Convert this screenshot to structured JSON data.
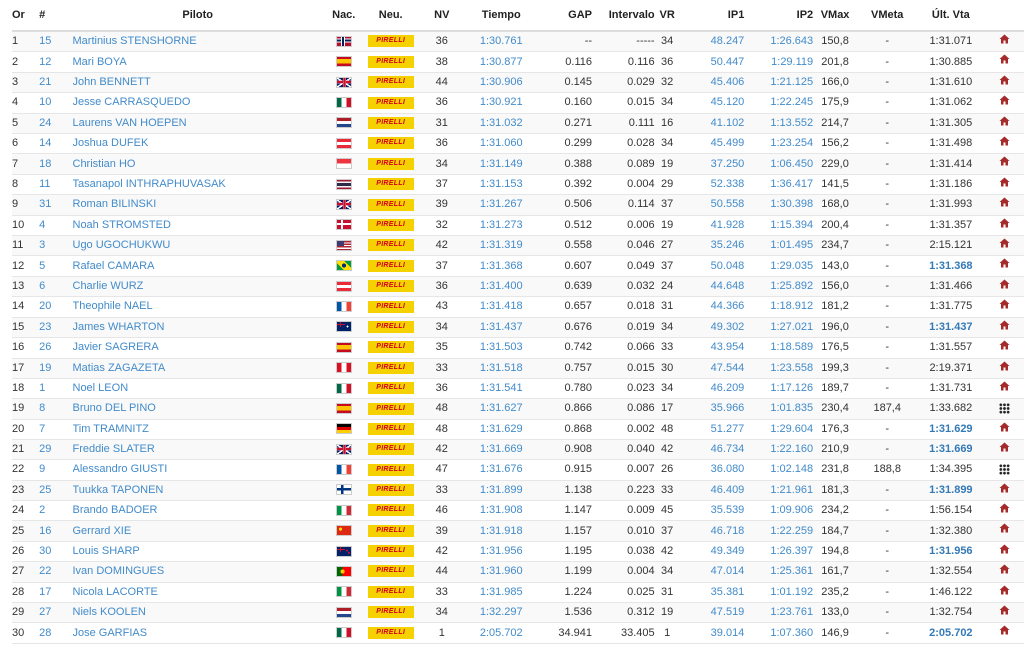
{
  "headers": {
    "or": "Or",
    "num": "#",
    "piloto": "Piloto",
    "nac": "Nac.",
    "neu": "Neu.",
    "nv": "NV",
    "tiempo": "Tiempo",
    "gap": "GAP",
    "intervalo": "Intervalo",
    "vr": "VR",
    "ip1": "IP1",
    "ip2": "IP2",
    "vmax": "VMax",
    "vmeta": "VMeta",
    "ultvta": "Últ. Vta"
  },
  "tyre_label": "PIRELLI",
  "colors": {
    "link": "#428bca",
    "best": "#337ab7",
    "house": "#a52a2a",
    "tyre_bg": "#f5d100",
    "tyre_text": "#d6001c"
  },
  "rows": [
    {
      "or": "1",
      "num": "15",
      "piloto": "Martinius STENSHORNE",
      "flag": "NO",
      "nv": "36",
      "tiempo": "1:30.761",
      "gap": "--",
      "intervalo": "-----",
      "vr": "34",
      "ip1": "48.247",
      "ip2": "1:26.643",
      "vmax": "150,8",
      "vmeta": "-",
      "ult": "1:31.071",
      "best": false,
      "icon": "home-icon"
    },
    {
      "or": "2",
      "num": "12",
      "piloto": "Mari BOYA",
      "flag": "ES",
      "nv": "38",
      "tiempo": "1:30.877",
      "gap": "0.116",
      "intervalo": "0.116",
      "vr": "36",
      "ip1": "50.447",
      "ip2": "1:29.119",
      "vmax": "201,8",
      "vmeta": "-",
      "ult": "1:30.885",
      "best": false,
      "icon": "home-icon"
    },
    {
      "or": "3",
      "num": "21",
      "piloto": "John BENNETT",
      "flag": "GB",
      "nv": "44",
      "tiempo": "1:30.906",
      "gap": "0.145",
      "intervalo": "0.029",
      "vr": "32",
      "ip1": "45.406",
      "ip2": "1:21.125",
      "vmax": "166,0",
      "vmeta": "-",
      "ult": "1:31.610",
      "best": false,
      "icon": "home-icon"
    },
    {
      "or": "4",
      "num": "10",
      "piloto": "Jesse CARRASQUEDO",
      "flag": "MX",
      "nv": "36",
      "tiempo": "1:30.921",
      "gap": "0.160",
      "intervalo": "0.015",
      "vr": "34",
      "ip1": "45.120",
      "ip2": "1:22.245",
      "vmax": "175,9",
      "vmeta": "-",
      "ult": "1:31.062",
      "best": false,
      "icon": "home-icon"
    },
    {
      "or": "5",
      "num": "24",
      "piloto": "Laurens VAN HOEPEN",
      "flag": "NL",
      "nv": "31",
      "tiempo": "1:31.032",
      "gap": "0.271",
      "intervalo": "0.111",
      "vr": "16",
      "ip1": "41.102",
      "ip2": "1:13.552",
      "vmax": "214,7",
      "vmeta": "-",
      "ult": "1:31.305",
      "best": false,
      "icon": "home-icon"
    },
    {
      "or": "6",
      "num": "14",
      "piloto": "Joshua DUFEK",
      "flag": "AT",
      "nv": "36",
      "tiempo": "1:31.060",
      "gap": "0.299",
      "intervalo": "0.028",
      "vr": "34",
      "ip1": "45.499",
      "ip2": "1:23.254",
      "vmax": "156,2",
      "vmeta": "-",
      "ult": "1:31.498",
      "best": false,
      "icon": "home-icon"
    },
    {
      "or": "7",
      "num": "18",
      "piloto": "Christian HO",
      "flag": "SG",
      "nv": "34",
      "tiempo": "1:31.149",
      "gap": "0.388",
      "intervalo": "0.089",
      "vr": "19",
      "ip1": "37.250",
      "ip2": "1:06.450",
      "vmax": "229,0",
      "vmeta": "-",
      "ult": "1:31.414",
      "best": false,
      "icon": "home-icon"
    },
    {
      "or": "8",
      "num": "11",
      "piloto": "Tasanapol INTHRAPHUVASAK",
      "flag": "TH",
      "nv": "37",
      "tiempo": "1:31.153",
      "gap": "0.392",
      "intervalo": "0.004",
      "vr": "29",
      "ip1": "52.338",
      "ip2": "1:36.417",
      "vmax": "141,5",
      "vmeta": "-",
      "ult": "1:31.186",
      "best": false,
      "icon": "home-icon"
    },
    {
      "or": "9",
      "num": "31",
      "piloto": "Roman BILINSKI",
      "flag": "GB",
      "nv": "39",
      "tiempo": "1:31.267",
      "gap": "0.506",
      "intervalo": "0.114",
      "vr": "37",
      "ip1": "50.558",
      "ip2": "1:30.398",
      "vmax": "168,0",
      "vmeta": "-",
      "ult": "1:31.993",
      "best": false,
      "icon": "home-icon"
    },
    {
      "or": "10",
      "num": "4",
      "piloto": "Noah STROMSTED",
      "flag": "DK",
      "nv": "32",
      "tiempo": "1:31.273",
      "gap": "0.512",
      "intervalo": "0.006",
      "vr": "19",
      "ip1": "41.928",
      "ip2": "1:15.394",
      "vmax": "200,4",
      "vmeta": "-",
      "ult": "1:31.357",
      "best": false,
      "icon": "home-icon"
    },
    {
      "or": "11",
      "num": "3",
      "piloto": "Ugo UGOCHUKWU",
      "flag": "US",
      "nv": "42",
      "tiempo": "1:31.319",
      "gap": "0.558",
      "intervalo": "0.046",
      "vr": "27",
      "ip1": "35.246",
      "ip2": "1:01.495",
      "vmax": "234,7",
      "vmeta": "-",
      "ult": "2:15.121",
      "best": false,
      "icon": "home-icon"
    },
    {
      "or": "12",
      "num": "5",
      "piloto": "Rafael CAMARA",
      "flag": "BR",
      "nv": "37",
      "tiempo": "1:31.368",
      "gap": "0.607",
      "intervalo": "0.049",
      "vr": "37",
      "ip1": "50.048",
      "ip2": "1:29.035",
      "vmax": "143,0",
      "vmeta": "-",
      "ult": "1:31.368",
      "best": true,
      "icon": "home-icon"
    },
    {
      "or": "13",
      "num": "6",
      "piloto": "Charlie WURZ",
      "flag": "AT",
      "nv": "36",
      "tiempo": "1:31.400",
      "gap": "0.639",
      "intervalo": "0.032",
      "vr": "24",
      "ip1": "44.648",
      "ip2": "1:25.892",
      "vmax": "156,0",
      "vmeta": "-",
      "ult": "1:31.466",
      "best": false,
      "icon": "home-icon"
    },
    {
      "or": "14",
      "num": "20",
      "piloto": "Theophile NAEL",
      "flag": "FR",
      "nv": "43",
      "tiempo": "1:31.418",
      "gap": "0.657",
      "intervalo": "0.018",
      "vr": "31",
      "ip1": "44.366",
      "ip2": "1:18.912",
      "vmax": "181,2",
      "vmeta": "-",
      "ult": "1:31.775",
      "best": false,
      "icon": "home-icon"
    },
    {
      "or": "15",
      "num": "23",
      "piloto": "James WHARTON",
      "flag": "AU",
      "nv": "34",
      "tiempo": "1:31.437",
      "gap": "0.676",
      "intervalo": "0.019",
      "vr": "34",
      "ip1": "49.302",
      "ip2": "1:27.021",
      "vmax": "196,0",
      "vmeta": "-",
      "ult": "1:31.437",
      "best": true,
      "icon": "home-icon"
    },
    {
      "or": "16",
      "num": "26",
      "piloto": "Javier SAGRERA",
      "flag": "ES",
      "nv": "35",
      "tiempo": "1:31.503",
      "gap": "0.742",
      "intervalo": "0.066",
      "vr": "33",
      "ip1": "43.954",
      "ip2": "1:18.589",
      "vmax": "176,5",
      "vmeta": "-",
      "ult": "1:31.557",
      "best": false,
      "icon": "home-icon"
    },
    {
      "or": "17",
      "num": "19",
      "piloto": "Matias ZAGAZETA",
      "flag": "PE",
      "nv": "33",
      "tiempo": "1:31.518",
      "gap": "0.757",
      "intervalo": "0.015",
      "vr": "30",
      "ip1": "47.544",
      "ip2": "1:23.558",
      "vmax": "199,3",
      "vmeta": "-",
      "ult": "2:19.371",
      "best": false,
      "icon": "home-icon"
    },
    {
      "or": "18",
      "num": "1",
      "piloto": "Noel LEON",
      "flag": "MX",
      "nv": "36",
      "tiempo": "1:31.541",
      "gap": "0.780",
      "intervalo": "0.023",
      "vr": "34",
      "ip1": "46.209",
      "ip2": "1:17.126",
      "vmax": "189,7",
      "vmeta": "-",
      "ult": "1:31.731",
      "best": false,
      "icon": "home-icon"
    },
    {
      "or": "19",
      "num": "8",
      "piloto": "Bruno DEL PINO",
      "flag": "ES",
      "nv": "48",
      "tiempo": "1:31.627",
      "gap": "0.866",
      "intervalo": "0.086",
      "vr": "17",
      "ip1": "35.966",
      "ip2": "1:01.835",
      "vmax": "230,4",
      "vmeta": "187,4",
      "ult": "1:33.682",
      "best": false,
      "icon": "grid-icon"
    },
    {
      "or": "20",
      "num": "7",
      "piloto": "Tim TRAMNITZ",
      "flag": "DE",
      "nv": "48",
      "tiempo": "1:31.629",
      "gap": "0.868",
      "intervalo": "0.002",
      "vr": "48",
      "ip1": "51.277",
      "ip2": "1:29.604",
      "vmax": "176,3",
      "vmeta": "-",
      "ult": "1:31.629",
      "best": true,
      "icon": "home-icon"
    },
    {
      "or": "21",
      "num": "29",
      "piloto": "Freddie SLATER",
      "flag": "GB",
      "nv": "42",
      "tiempo": "1:31.669",
      "gap": "0.908",
      "intervalo": "0.040",
      "vr": "42",
      "ip1": "46.734",
      "ip2": "1:22.160",
      "vmax": "210,9",
      "vmeta": "-",
      "ult": "1:31.669",
      "best": true,
      "icon": "home-icon"
    },
    {
      "or": "22",
      "num": "9",
      "piloto": "Alessandro GIUSTI",
      "flag": "FR",
      "nv": "47",
      "tiempo": "1:31.676",
      "gap": "0.915",
      "intervalo": "0.007",
      "vr": "26",
      "ip1": "36.080",
      "ip2": "1:02.148",
      "vmax": "231,8",
      "vmeta": "188,8",
      "ult": "1:34.395",
      "best": false,
      "icon": "grid-icon"
    },
    {
      "or": "23",
      "num": "25",
      "piloto": "Tuukka TAPONEN",
      "flag": "FI",
      "nv": "33",
      "tiempo": "1:31.899",
      "gap": "1.138",
      "intervalo": "0.223",
      "vr": "33",
      "ip1": "46.409",
      "ip2": "1:21.961",
      "vmax": "181,3",
      "vmeta": "-",
      "ult": "1:31.899",
      "best": true,
      "icon": "home-icon"
    },
    {
      "or": "24",
      "num": "2",
      "piloto": "Brando BADOER",
      "flag": "IT",
      "nv": "46",
      "tiempo": "1:31.908",
      "gap": "1.147",
      "intervalo": "0.009",
      "vr": "45",
      "ip1": "35.539",
      "ip2": "1:09.906",
      "vmax": "234,2",
      "vmeta": "-",
      "ult": "1:56.154",
      "best": false,
      "icon": "home-icon"
    },
    {
      "or": "25",
      "num": "16",
      "piloto": "Gerrard XIE",
      "flag": "CN",
      "nv": "39",
      "tiempo": "1:31.918",
      "gap": "1.157",
      "intervalo": "0.010",
      "vr": "37",
      "ip1": "46.718",
      "ip2": "1:22.259",
      "vmax": "184,7",
      "vmeta": "-",
      "ult": "1:32.380",
      "best": false,
      "icon": "home-icon"
    },
    {
      "or": "26",
      "num": "30",
      "piloto": "Louis SHARP",
      "flag": "NZ",
      "nv": "42",
      "tiempo": "1:31.956",
      "gap": "1.195",
      "intervalo": "0.038",
      "vr": "42",
      "ip1": "49.349",
      "ip2": "1:26.397",
      "vmax": "194,8",
      "vmeta": "-",
      "ult": "1:31.956",
      "best": true,
      "icon": "home-icon"
    },
    {
      "or": "27",
      "num": "22",
      "piloto": "Ivan DOMINGUES",
      "flag": "PT",
      "nv": "44",
      "tiempo": "1:31.960",
      "gap": "1.199",
      "intervalo": "0.004",
      "vr": "34",
      "ip1": "47.014",
      "ip2": "1:25.361",
      "vmax": "161,7",
      "vmeta": "-",
      "ult": "1:32.554",
      "best": false,
      "icon": "home-icon"
    },
    {
      "or": "28",
      "num": "17",
      "piloto": "Nicola LACORTE",
      "flag": "IT",
      "nv": "33",
      "tiempo": "1:31.985",
      "gap": "1.224",
      "intervalo": "0.025",
      "vr": "31",
      "ip1": "35.381",
      "ip2": "1:01.192",
      "vmax": "235,2",
      "vmeta": "-",
      "ult": "1:46.122",
      "best": false,
      "icon": "home-icon"
    },
    {
      "or": "29",
      "num": "27",
      "piloto": "Niels KOOLEN",
      "flag": "NL",
      "nv": "34",
      "tiempo": "1:32.297",
      "gap": "1.536",
      "intervalo": "0.312",
      "vr": "19",
      "ip1": "47.519",
      "ip2": "1:23.761",
      "vmax": "133,0",
      "vmeta": "-",
      "ult": "1:32.754",
      "best": false,
      "icon": "home-icon"
    },
    {
      "or": "30",
      "num": "28",
      "piloto": "Jose GARFIAS",
      "flag": "MX",
      "nv": "1",
      "tiempo": "2:05.702",
      "gap": "34.941",
      "intervalo": "33.405",
      "vr": "1",
      "ip1": "39.014",
      "ip2": "1:07.360",
      "vmax": "146,9",
      "vmeta": "-",
      "ult": "2:05.702",
      "best": true,
      "icon": "home-icon"
    }
  ]
}
